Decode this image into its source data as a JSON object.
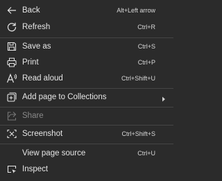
{
  "menu": {
    "items": [
      {
        "label": "Back",
        "shortcut": "Alt+Left arrow",
        "icon": "back-arrow-icon"
      },
      {
        "label": "Refresh",
        "shortcut": "Ctrl+R",
        "icon": "refresh-icon"
      },
      {
        "label": "Save as",
        "shortcut": "Ctrl+S",
        "icon": "save-as-icon"
      },
      {
        "label": "Print",
        "shortcut": "Ctrl+P",
        "icon": "print-icon"
      },
      {
        "label": "Read aloud",
        "shortcut": "Ctrl+Shift+U",
        "icon": "read-aloud-icon"
      },
      {
        "label": "Add page to Collections",
        "shortcut": "",
        "icon": "collections-icon",
        "submenu": true
      },
      {
        "label": "Share",
        "shortcut": "",
        "icon": "share-icon",
        "disabled": true
      },
      {
        "label": "Screenshot",
        "shortcut": "Ctrl+Shift+S",
        "icon": "screenshot-icon"
      },
      {
        "label": "View page source",
        "shortcut": "Ctrl+U",
        "icon": ""
      },
      {
        "label": "Inspect",
        "shortcut": "",
        "icon": "inspect-icon"
      }
    ]
  }
}
